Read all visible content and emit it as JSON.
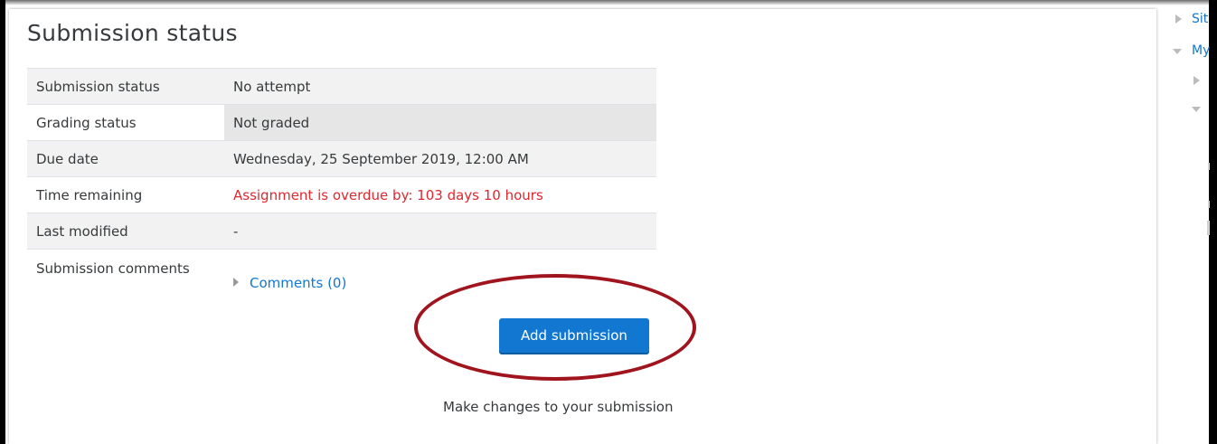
{
  "heading": "Submission status",
  "status_rows": [
    {
      "label": "Submission status",
      "value": "No attempt"
    },
    {
      "label": "Grading status",
      "value": "Not graded"
    },
    {
      "label": "Due date",
      "value": "Wednesday, 25 September 2019, 12:00 AM"
    },
    {
      "label": "Time remaining",
      "value": "Assignment is overdue by: 103 days 10 hours"
    },
    {
      "label": "Last modified",
      "value": "-"
    },
    {
      "label": "Submission comments",
      "value": "Comments (0)"
    }
  ],
  "add_submission_label": "Add submission",
  "help_text": "Make changes to your submission",
  "sidebar": {
    "item1": "Sit",
    "item2": "My"
  },
  "colors": {
    "accent": "#1177d1",
    "overdue": "#e3262e",
    "annotation_circle": "#a0141e"
  },
  "icons": [
    "chevron-right-icon",
    "chevron-down-icon"
  ]
}
